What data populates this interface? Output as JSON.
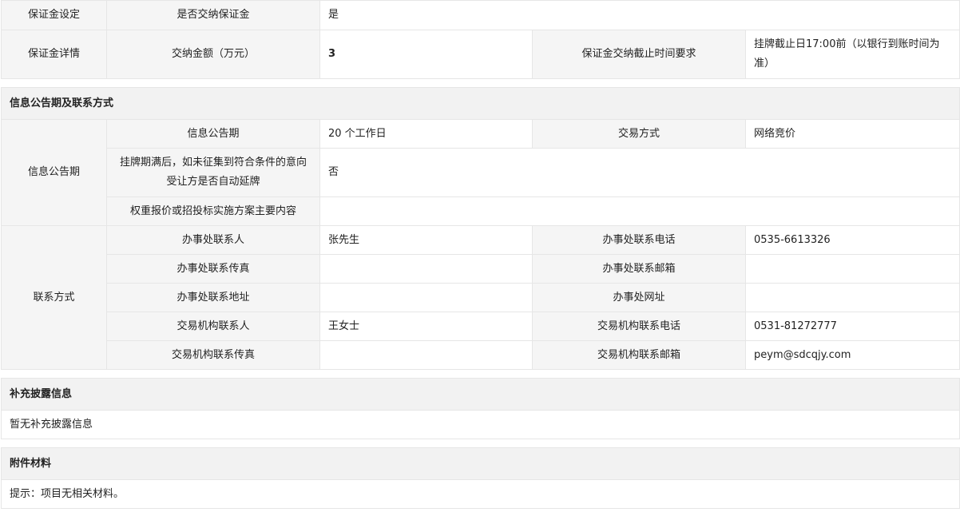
{
  "deposit": {
    "setting_label": "保证金设定",
    "required_label": "是否交纳保证金",
    "required_value": "是",
    "detail_label": "保证金详情",
    "amount_label": "交纳金额（万元）",
    "amount_value": "3",
    "deadline_label": "保证金交纳截止时间要求",
    "deadline_value": "挂牌截止日17:00前（以银行到账时间为准）"
  },
  "announcement": {
    "section_title": "信息公告期及联系方式",
    "group_label": "信息公告期",
    "period_label": "信息公告期",
    "period_value": "20 个工作日",
    "trade_method_label": "交易方式",
    "trade_method_value": "网络竞价",
    "extension_label": "挂牌期满后，如未征集到符合条件的意向受让方是否自动延牌",
    "extension_value": "否",
    "scheme_label": "权重报价或招投标实施方案主要内容",
    "scheme_value": ""
  },
  "contact": {
    "group_label": "联系方式",
    "office_contact_label": "办事处联系人",
    "office_contact_value": "张先生",
    "office_phone_label": "办事处联系电话",
    "office_phone_value": "0535-6613326",
    "office_fax_label": "办事处联系传真",
    "office_fax_value": "",
    "office_email_label": "办事处联系邮箱",
    "office_email_value": "",
    "office_address_label": "办事处联系地址",
    "office_address_value": "",
    "office_website_label": "办事处网址",
    "office_website_value": "",
    "agency_contact_label": "交易机构联系人",
    "agency_contact_value": "王女士",
    "agency_phone_label": "交易机构联系电话",
    "agency_phone_value": "0531-81272777",
    "agency_fax_label": "交易机构联系传真",
    "agency_fax_value": "",
    "agency_email_label": "交易机构联系邮箱",
    "agency_email_value": "peym@sdcqjy.com"
  },
  "supplement": {
    "section_title": "补充披露信息",
    "empty_text": "暂无补充披露信息"
  },
  "attachments": {
    "section_title": "附件材料",
    "tip_text": "提示：项目无相关材料。"
  }
}
